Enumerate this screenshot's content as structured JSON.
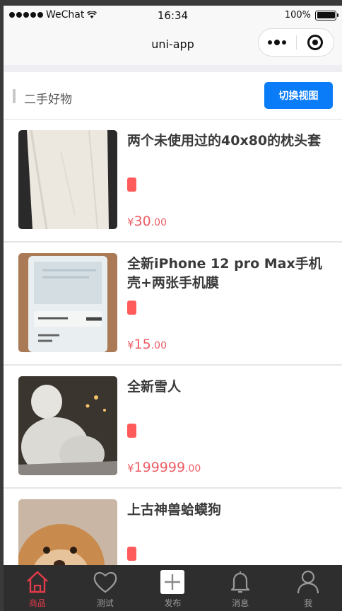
{
  "status_bar": {
    "carrier": "WeChat",
    "time": "16:34",
    "battery": "100%",
    "battery_level": 1.0
  },
  "nav": {
    "title": "uni-app"
  },
  "section": {
    "title": "二手好物",
    "switch_button": "切换视图"
  },
  "products": [
    {
      "title": "两个未使用过的40x80的枕头套",
      "currency": "¥",
      "price_int": "30",
      "price_dec": ".00",
      "image": "pillowcase"
    },
    {
      "title": "全新iPhone 12 pro Max手机壳+两张手机膜",
      "currency": "¥",
      "price_int": "15",
      "price_dec": ".00",
      "image": "phone-case"
    },
    {
      "title": "全新雪人",
      "currency": "¥",
      "price_int": "199999",
      "price_dec": ".00",
      "image": "snowman"
    },
    {
      "title": "上古神兽蛤蟆狗",
      "currency": "¥",
      "price_int": "",
      "price_dec": "",
      "image": "dog"
    }
  ],
  "tabs": [
    {
      "label": "商品",
      "icon": "home-icon",
      "active": true
    },
    {
      "label": "测试",
      "icon": "heart-icon",
      "active": false
    },
    {
      "label": "发布",
      "icon": "plus-icon",
      "active": false
    },
    {
      "label": "消息",
      "icon": "bell-icon",
      "active": false
    },
    {
      "label": "我",
      "icon": "user-icon",
      "active": false
    }
  ],
  "colors": {
    "accent_blue": "#0a7cf7",
    "price_red": "#ec5d65",
    "tag_red": "#ff5b5b",
    "tab_active": "#e23b4a",
    "tab_bar_bg": "#2e2e2e"
  }
}
